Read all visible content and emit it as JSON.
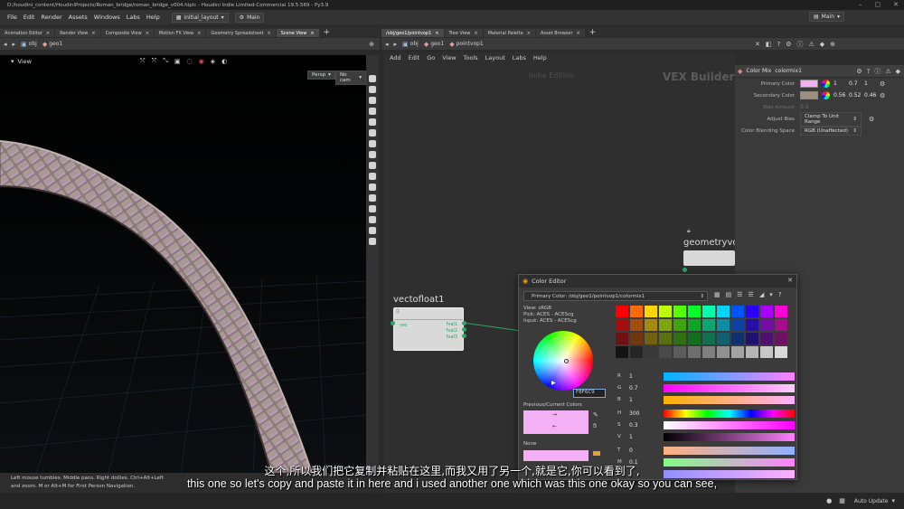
{
  "window": {
    "title": "D:/houdini_content/HoudiniProjects/Roman_bridge/roman_bridge_v004.hiplc - Houdini Indie Limited-Commercial 19.5.569 - Py3.9"
  },
  "menu": {
    "items": [
      "File",
      "Edit",
      "Render",
      "Assets",
      "Windows",
      "Labs",
      "Help"
    ],
    "desk": "initial_layout",
    "main": "Main",
    "right_desk": "Main"
  },
  "left_tabs": [
    "Animation Editor",
    "Render View",
    "Composite View",
    "Motion FX View",
    "Geometry Spreadsheet",
    "Scene View"
  ],
  "left_path": {
    "root": "obj",
    "node": "geo1"
  },
  "viewport": {
    "label": "View",
    "persp": "Persp",
    "cam": "No cam"
  },
  "status_text": {
    "line1": "Left mouse tumbles. Middle pans. Right dollies. Ctrl+Alt+Left",
    "line2": "and zoom.    M or Alt+M for First Person Navigation."
  },
  "right_tabs": [
    "/obj/geo1/pointvop1",
    "Tree View",
    "Material Palette",
    "Asset Browser"
  ],
  "right_path": {
    "root": "obj",
    "node": "geo1",
    "vop": "pointvop1"
  },
  "net_menu": [
    "Add",
    "Edit",
    "Go",
    "View",
    "Tools",
    "Layout",
    "Labs",
    "Help"
  ],
  "network": {
    "edition": "Indie Edition",
    "builder": "VEX Builder",
    "node1": "vectofloat1",
    "node1_in": "vec",
    "node1_outs": [
      "fval1",
      "fval2",
      "fval3"
    ],
    "node2": "geometryvo"
  },
  "params": {
    "header_type": "Color Mix",
    "header_name": "colormix1",
    "primary_label": "Primary Color",
    "primary_vals": [
      "1",
      "0.7",
      "1"
    ],
    "primary_color": "#f3b0f5",
    "secondary_label": "Secondary Color",
    "secondary_vals": [
      "0.56",
      "0.52",
      "0.46"
    ],
    "secondary_color": "#9c8f80",
    "bias_label": "Bias Amount",
    "bias_val": "0.5",
    "adjust_label": "Adjust Bias",
    "adjust_val": "Clamp To Unit Range",
    "blend_label": "Color Blending Space",
    "blend_val": "RGB (Unaffected)"
  },
  "color_editor": {
    "title": "Color Editor",
    "primary_path": "Primary Color: /obj/geo1/pointvop1/colormix1",
    "view": "View:   sRGB",
    "pick": "Pick:   ACES - ACEScg",
    "input": "Input:  ACES - ACEScg",
    "hex": "F8F6C9",
    "prev_label": "Previous/Current Colors",
    "none_label": "None",
    "rgb_labels": [
      "R",
      "G",
      "B"
    ],
    "rgb_vals": [
      "1",
      "0.7",
      "1"
    ],
    "hsv_labels": [
      "H",
      "S",
      "V"
    ],
    "hsv_vals": [
      "300",
      "0.3",
      "1"
    ],
    "tmi_labels": [
      "T",
      "M",
      ""
    ],
    "tmi_vals": [
      "0",
      "0.1",
      ""
    ]
  },
  "bottom": {
    "auto_update": "Auto Update"
  },
  "subtitles": {
    "zh": "这个,所以我们把它复制并粘贴在这里,而我又用了另一个,就是它,你可以看到了,",
    "en": "this one so let's copy and paste it in here and i used another one which was this one okay so you can see,"
  }
}
